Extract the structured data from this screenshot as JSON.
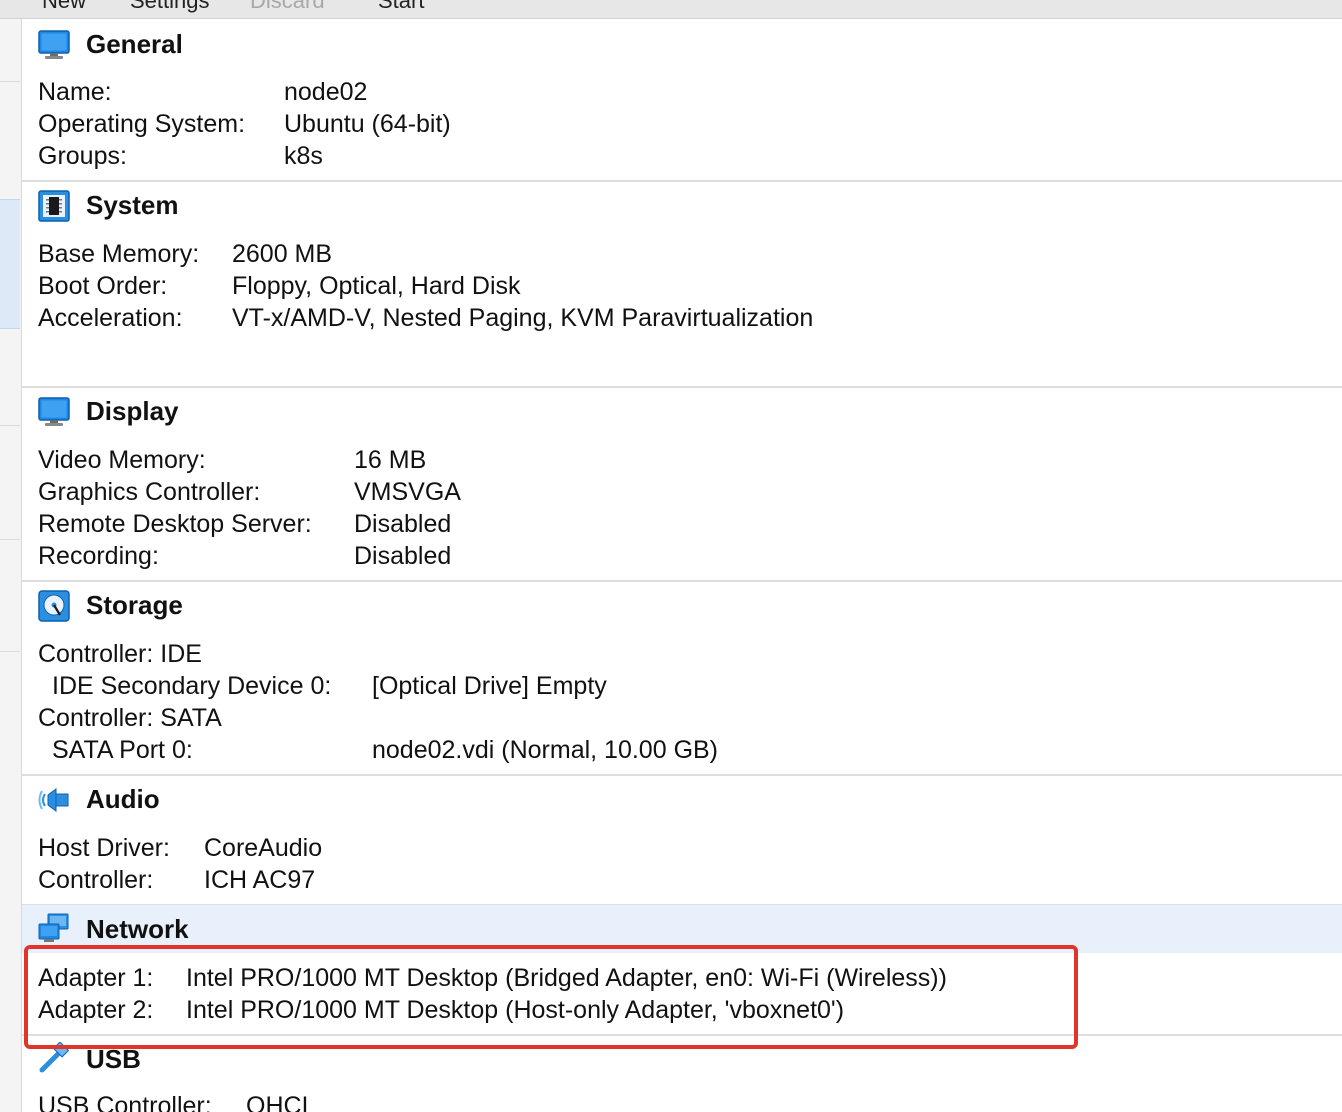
{
  "toolbar": {
    "items": [
      "New",
      "Settings",
      "Discard",
      "Start"
    ]
  },
  "sections": {
    "general": {
      "title": "General",
      "icon": "monitor-icon",
      "rows": [
        {
          "label": "Name:",
          "value": "node02"
        },
        {
          "label": "Operating System:",
          "value": "Ubuntu (64-bit)"
        },
        {
          "label": "Groups:",
          "value": "k8s"
        }
      ]
    },
    "system": {
      "title": "System",
      "icon": "chip-icon",
      "rows": [
        {
          "label": "Base Memory:",
          "value": "2600 MB"
        },
        {
          "label": "Boot Order:",
          "value": "Floppy, Optical, Hard Disk"
        },
        {
          "label": "Acceleration:",
          "value": "VT-x/AMD-V, Nested Paging, KVM Paravirtualization"
        }
      ]
    },
    "display": {
      "title": "Display",
      "icon": "display-icon",
      "rows": [
        {
          "label": "Video Memory:",
          "value": "16 MB"
        },
        {
          "label": "Graphics Controller:",
          "value": "VMSVGA"
        },
        {
          "label": "Remote Desktop Server:",
          "value": "Disabled"
        },
        {
          "label": "Recording:",
          "value": "Disabled"
        }
      ]
    },
    "storage": {
      "title": "Storage",
      "icon": "disk-icon",
      "rows": [
        {
          "label": "Controller: IDE",
          "value": ""
        },
        {
          "label": "IDE Secondary Device 0:",
          "value": "[Optical Drive] Empty"
        },
        {
          "label": "Controller: SATA",
          "value": ""
        },
        {
          "label": "SATA Port 0:",
          "value": "node02.vdi (Normal, 10.00 GB)"
        }
      ]
    },
    "audio": {
      "title": "Audio",
      "icon": "speaker-icon",
      "rows": [
        {
          "label": "Host Driver:",
          "value": "CoreAudio"
        },
        {
          "label": "Controller:",
          "value": "ICH AC97"
        }
      ]
    },
    "network": {
      "title": "Network",
      "icon": "network-icon",
      "rows": [
        {
          "label": "Adapter 1:",
          "value": "Intel PRO/1000 MT Desktop (Bridged Adapter, en0: Wi-Fi (Wireless))"
        },
        {
          "label": "Adapter 2:",
          "value": "Intel PRO/1000 MT Desktop (Host-only Adapter, 'vboxnet0')"
        }
      ]
    },
    "usb": {
      "title": "USB",
      "icon": "usb-icon",
      "rows": [
        {
          "label": "USB Controller:",
          "value": "OHCI"
        }
      ]
    }
  },
  "colors": {
    "accent": "#1e88e5",
    "highlight": "#e0352b",
    "network_header": "#e8f0fb"
  }
}
